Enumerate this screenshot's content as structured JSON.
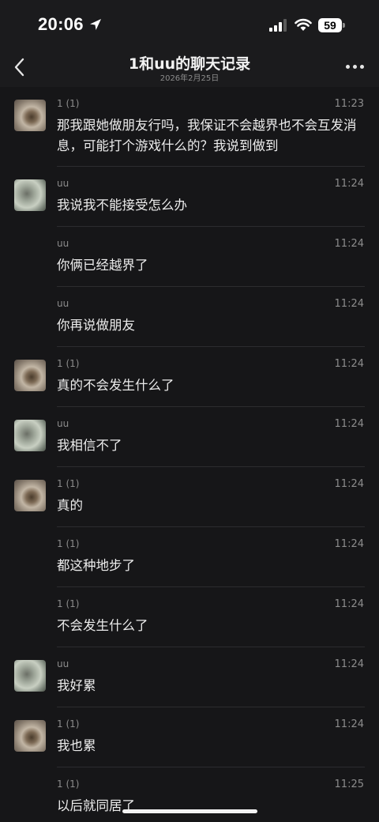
{
  "status_bar": {
    "time": "20:06",
    "battery": "59"
  },
  "nav": {
    "title": "1和uu的聊天记录",
    "subtitle": "2026年2月25日"
  },
  "messages": [
    {
      "sender": "1 (1)",
      "time": "11:23",
      "text": "那我跟她做朋友行吗，我保证不会越界也不会互发消息，可能打个游戏什么的？我说到做到",
      "avatar": "a"
    },
    {
      "sender": "uu",
      "time": "11:24",
      "text": "我说我不能接受怎么办",
      "avatar": "b"
    },
    {
      "sender": "uu",
      "time": "11:24",
      "text": "你俩已经越界了",
      "avatar": ""
    },
    {
      "sender": "uu",
      "time": "11:24",
      "text": "你再说做朋友",
      "avatar": ""
    },
    {
      "sender": "1 (1)",
      "time": "11:24",
      "text": "真的不会发生什么了",
      "avatar": "a"
    },
    {
      "sender": "uu",
      "time": "11:24",
      "text": "我相信不了",
      "avatar": "b"
    },
    {
      "sender": "1 (1)",
      "time": "11:24",
      "text": "真的",
      "avatar": "a"
    },
    {
      "sender": "1 (1)",
      "time": "11:24",
      "text": "都这种地步了",
      "avatar": ""
    },
    {
      "sender": "1 (1)",
      "time": "11:24",
      "text": "不会发生什么了",
      "avatar": ""
    },
    {
      "sender": "uu",
      "time": "11:24",
      "text": "我好累",
      "avatar": "b"
    },
    {
      "sender": "1 (1)",
      "time": "11:24",
      "text": "我也累",
      "avatar": "a"
    },
    {
      "sender": "1 (1)",
      "time": "11:25",
      "text": "以后就同居了",
      "avatar": ""
    }
  ]
}
